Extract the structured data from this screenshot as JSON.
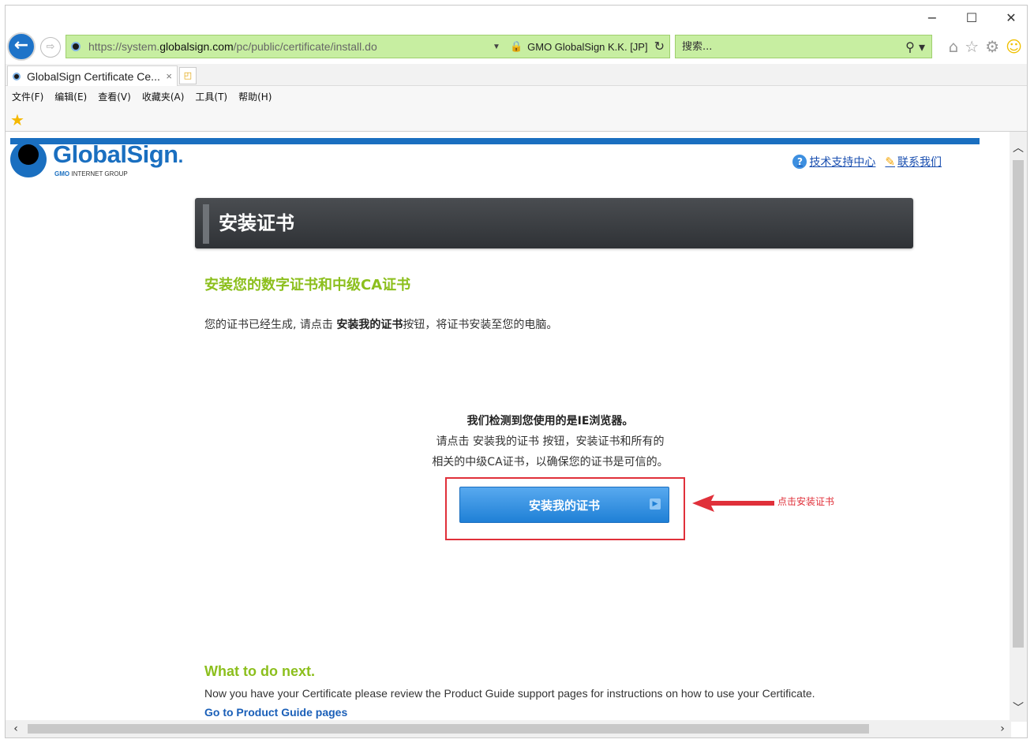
{
  "window": {
    "minimize": "−",
    "maximize": "☐",
    "close": "✕"
  },
  "address_bar": {
    "url_proto": "https://system.",
    "url_domain": "globalsign.com",
    "url_path": "/pc/public/certificate/install.do",
    "cert_owner": "GMO GlobalSign K.K. [JP]",
    "search_placeholder": "搜索..."
  },
  "tab": {
    "title": "GlobalSign Certificate Ce...",
    "close": "×"
  },
  "menu": {
    "items": [
      "文件(F)",
      "编辑(E)",
      "查看(V)",
      "收藏夹(A)",
      "工具(T)",
      "帮助(H)"
    ]
  },
  "page": {
    "logo_name": "GlobalSign",
    "logo_sub_brand": "GMO",
    "logo_sub": "INTERNET GROUP",
    "top_links": {
      "support": "技术支持中心",
      "contact": "联系我们"
    },
    "header_title": "安装证书",
    "section_title": "安装您的数字证书和中级CA证书",
    "intro_before": "您的证书已经生成, 请点击 ",
    "intro_bold": "安装我的证书",
    "intro_after": "按钮，将证书安装至您的电脑。",
    "detect_line1": "我们检测到您使用的是IE浏览器。",
    "detect_line2": "请点击 安装我的证书 按钮，安装证书和所有的",
    "detect_line3": "相关的中级CA证书，以确保您的证书是可信的。",
    "install_button": "安装我的证书",
    "annotation": "点击安装证书",
    "next_title": "What to do next.",
    "next_text": "Now you have your Certificate please review the Product Guide support pages for instructions on how to use your Certificate.",
    "next_link": "Go to Product Guide pages"
  },
  "colors": {
    "brand_blue": "#1a6fc0",
    "accent_green": "#8cbf1d",
    "address_green": "#c7eea1",
    "annotation_red": "#e0303a"
  }
}
